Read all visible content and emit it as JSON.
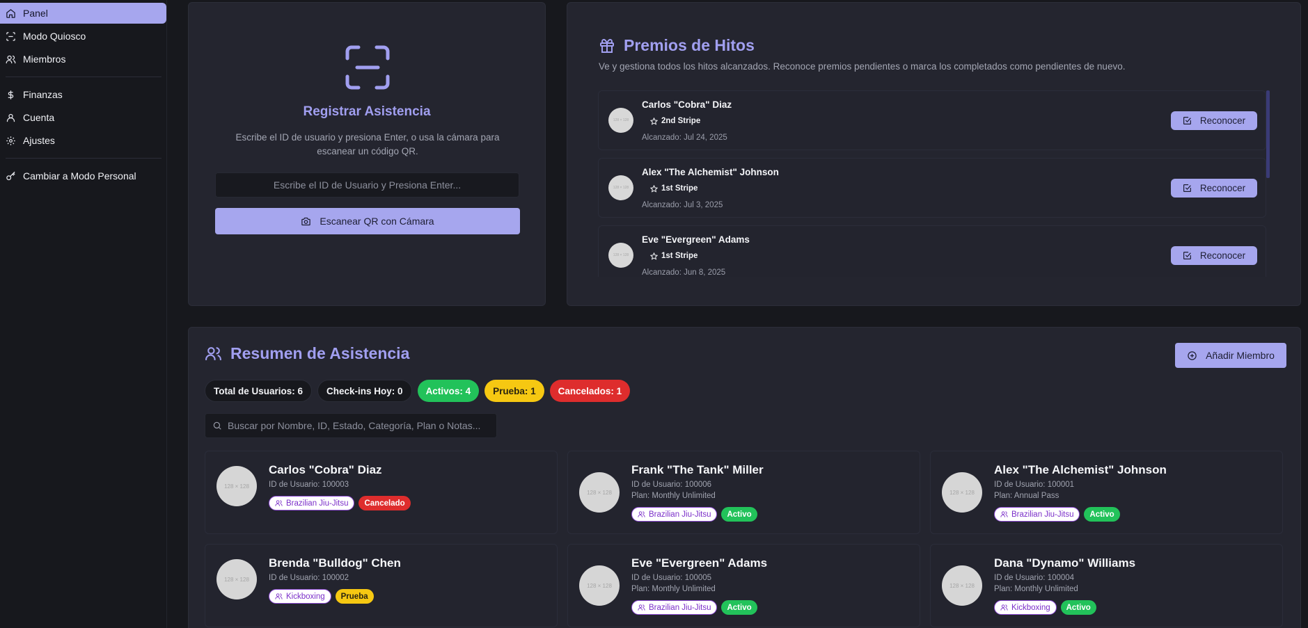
{
  "sidebar": {
    "items": [
      {
        "label": "Panel",
        "icon": "home-icon"
      },
      {
        "label": "Modo Quiosco",
        "icon": "scan-icon"
      },
      {
        "label": "Miembros",
        "icon": "users-icon"
      },
      {
        "label": "Finanzas",
        "icon": "dollar-icon"
      },
      {
        "label": "Cuenta",
        "icon": "user-icon"
      },
      {
        "label": "Ajustes",
        "icon": "gear-icon"
      },
      {
        "label": "Cambiar a Modo Personal",
        "icon": "key-icon"
      }
    ],
    "accent": "#a6a6ee"
  },
  "checkin": {
    "title": "Registrar Asistencia",
    "description": "Escribe el ID de usuario y presiona Enter, o usa la cámara para escanear un código QR.",
    "input_placeholder": "Escribe el ID de Usuario y Presiona Enter...",
    "scan_button": "Escanear QR con Cámara"
  },
  "milestones": {
    "title": "Premios de Hitos",
    "description": "Ve y gestiona todos los hitos alcanzados. Reconoce premios pendientes o marca los completados como pendientes de nuevo.",
    "items": [
      {
        "name": "Carlos \"Cobra\" Diaz",
        "award": "2nd Stripe",
        "date": "Alcanzado: Jul 24, 2025",
        "button": "Reconocer",
        "avatar": "128 × 128"
      },
      {
        "name": "Alex \"The Alchemist\" Johnson",
        "award": "1st Stripe",
        "date": "Alcanzado: Jul 3, 2025",
        "button": "Reconocer",
        "avatar": "128 × 128"
      },
      {
        "name": "Eve \"Evergreen\" Adams",
        "award": "1st Stripe",
        "date": "Alcanzado: Jun 8, 2025",
        "button": "Reconocer",
        "avatar": "128 × 128"
      }
    ]
  },
  "summary": {
    "title": "Resumen de Asistencia",
    "add_button": "Añadir Miembro",
    "stats": {
      "total": "Total de Usuarios: 6",
      "checkins": "Check-ins Hoy: 0",
      "active": "Activos: 4",
      "trial": "Prueba: 1",
      "cancelled": "Cancelados: 1"
    },
    "search_placeholder": "Buscar por Nombre, ID, Estado, Categoría, Plan o Notas...",
    "members": [
      {
        "name": "Carlos \"Cobra\" Diaz",
        "id": "ID de Usuario: 100003",
        "plan": "",
        "category": "Brazilian Jiu-Jitsu",
        "status": "Cancelado",
        "status_type": "cancelado",
        "avatar": "128 × 128"
      },
      {
        "name": "Frank \"The Tank\" Miller",
        "id": "ID de Usuario: 100006",
        "plan": "Plan: Monthly Unlimited",
        "category": "Brazilian Jiu-Jitsu",
        "status": "Activo",
        "status_type": "activo",
        "avatar": "128 × 128"
      },
      {
        "name": "Alex \"The Alchemist\" Johnson",
        "id": "ID de Usuario: 100001",
        "plan": "Plan: Annual Pass",
        "category": "Brazilian Jiu-Jitsu",
        "status": "Activo",
        "status_type": "activo",
        "avatar": "128 × 128"
      },
      {
        "name": "Brenda \"Bulldog\" Chen",
        "id": "ID de Usuario: 100002",
        "plan": "",
        "category": "Kickboxing",
        "status": "Prueba",
        "status_type": "prueba",
        "avatar": "128 × 128"
      },
      {
        "name": "Eve \"Evergreen\" Adams",
        "id": "ID de Usuario: 100005",
        "plan": "Plan: Monthly Unlimited",
        "category": "Brazilian Jiu-Jitsu",
        "status": "Activo",
        "status_type": "activo",
        "avatar": "128 × 128"
      },
      {
        "name": "Dana \"Dynamo\" Williams",
        "id": "ID de Usuario: 100004",
        "plan": "Plan: Monthly Unlimited",
        "category": "Kickboxing",
        "status": "Activo",
        "status_type": "activo",
        "avatar": "128 × 128"
      }
    ]
  }
}
